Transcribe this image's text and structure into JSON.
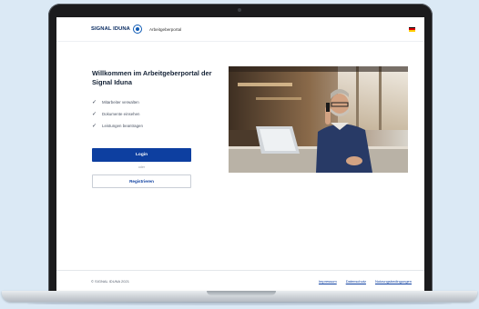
{
  "header": {
    "logo_text": "SIGNAL IDUNA",
    "portal_name": "Arbeitgeberportal",
    "language_flag": "german-flag-icon",
    "flag_colors": [
      "#000000",
      "#dd0000",
      "#ffce00"
    ]
  },
  "main": {
    "welcome_title": "Willkommen im Arbeitgeberportal der Signal Iduna",
    "checklist": [
      "Mitarbeiter verwalten",
      "Dokumente einsehen",
      "Leistungen beantragen"
    ],
    "login_label": "Login",
    "or_label": "oder",
    "register_label": "Registrieren"
  },
  "hero_image": {
    "description_icon": "man-on-phone-with-laptop-photo"
  },
  "footer": {
    "copyright": "© SIGNAL IDUNA 2021",
    "links": [
      "Impressum",
      "Datenschutz",
      "Nutzungsbedingungen"
    ]
  },
  "colors": {
    "brand_blue": "#0d3fa0",
    "background": "#dbe9f5"
  }
}
